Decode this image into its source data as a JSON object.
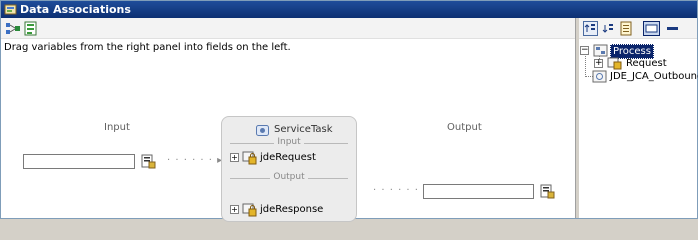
{
  "window": {
    "title": "Data Associations"
  },
  "toolbar": {
    "buttons": [
      "auto-map-icon",
      "expression-builder-icon"
    ]
  },
  "hint": "Drag variables from the right panel into fields on the left.",
  "mapping": {
    "input_label": "Input",
    "output_label": "Output",
    "input_value": "",
    "output_value": "",
    "arrow": "· · · · · · ▸"
  },
  "task": {
    "title": "ServiceTask",
    "input_section": "Input",
    "output_section": "Output",
    "input_var": "jdeRequest",
    "output_var": "jdeResponse",
    "expander": "+"
  },
  "tree": {
    "root": "Process",
    "child": "Request",
    "sibling": "JDE_JCA_Outbound",
    "collapse": "−",
    "expand": "+"
  },
  "colors": {
    "titlebar": "#0c2f72",
    "selection": "#0a246a",
    "task_bg": "#ececec"
  }
}
